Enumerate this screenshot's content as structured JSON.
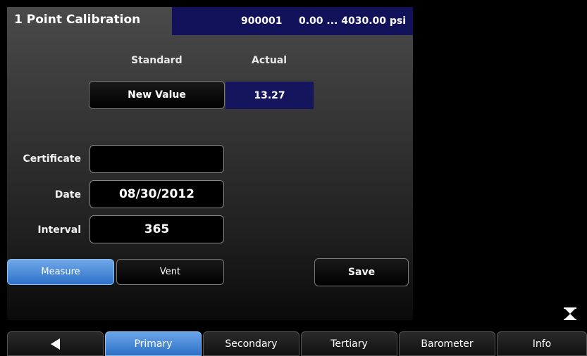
{
  "header": {
    "title": "1 Point Calibration",
    "serial": "900001",
    "range": "0.00 ... 4030.00 psi"
  },
  "columns": {
    "standard": "Standard",
    "actual": "Actual"
  },
  "calibration": {
    "new_value_label": "New Value",
    "actual_value": "13.27"
  },
  "fields": {
    "certificate_label": "Certificate",
    "certificate_value": "",
    "date_label": "Date",
    "date_value": "08/30/2012",
    "interval_label": "Interval",
    "interval_value": "365"
  },
  "actions": {
    "measure": "Measure",
    "vent": "Vent",
    "save": "Save"
  },
  "tabs": [
    {
      "label": "",
      "icon": "back-arrow-icon"
    },
    {
      "label": "Primary"
    },
    {
      "label": "Secondary"
    },
    {
      "label": "Tertiary"
    },
    {
      "label": "Barometer"
    },
    {
      "label": "Info"
    }
  ],
  "colors": {
    "accent_blue": "#2f72c9",
    "range_box": "#12125a"
  }
}
